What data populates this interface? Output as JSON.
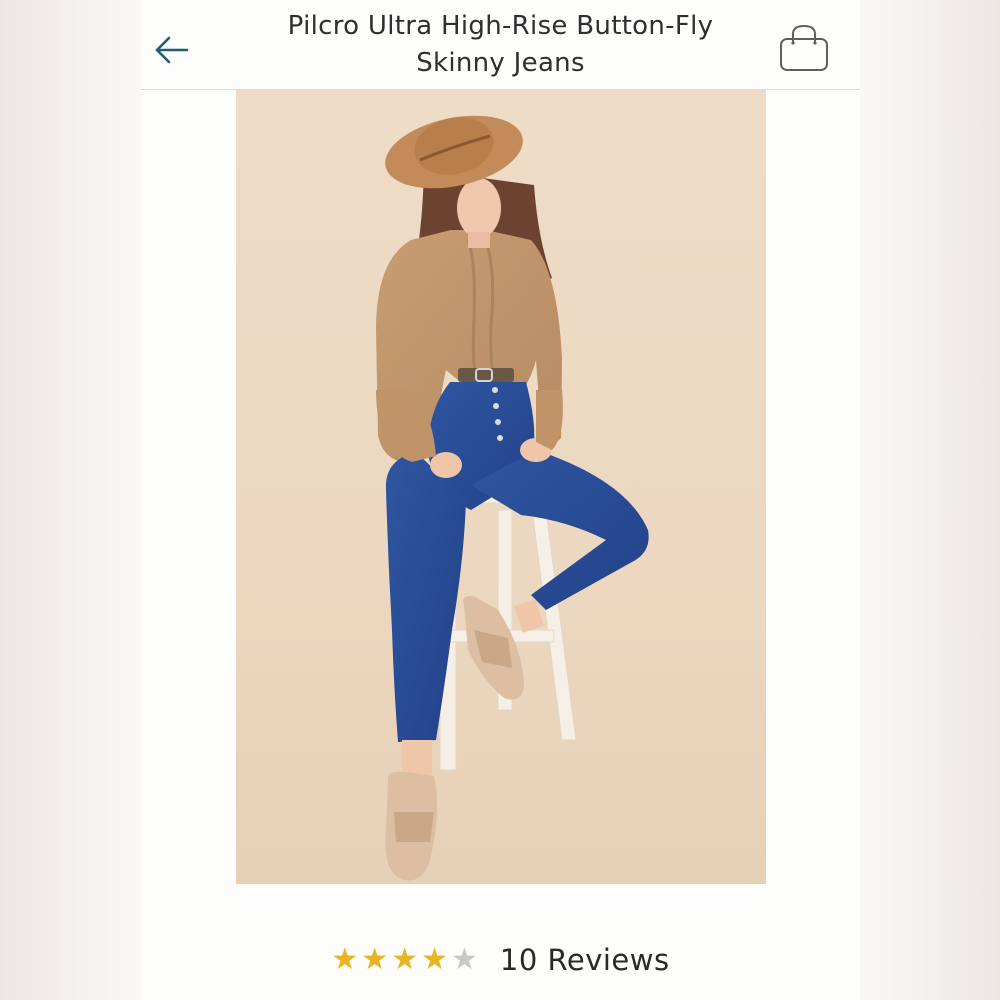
{
  "header": {
    "title": "Pilcro Ultra High-Rise Button-Fly Skinny Jeans",
    "back_icon": "arrow-left-icon",
    "bag_icon": "shopping-bag-icon"
  },
  "product": {
    "image_icon": "product-photo"
  },
  "rating": {
    "value": 4,
    "max": 5,
    "filled_color": "#e8b523",
    "empty_color": "#c9c9c9",
    "stars": [
      "★",
      "★",
      "★",
      "★",
      "★"
    ],
    "reviews_label": "10 Reviews"
  },
  "colors": {
    "accent": "#1f5e6e",
    "background": "#fdfdfc",
    "photo_background": "#ecd9c2"
  }
}
